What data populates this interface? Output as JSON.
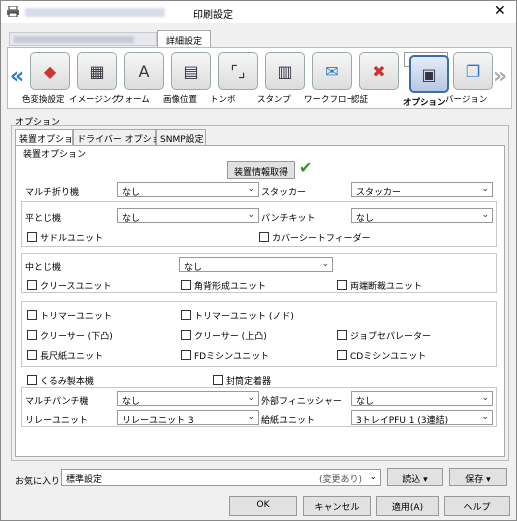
{
  "window": {
    "title": "印刷設定",
    "close": "✕"
  },
  "tabs": {
    "detail": "詳細設定"
  },
  "ribbon": {
    "items": [
      {
        "label": "色変換設定",
        "glyph": "◆"
      },
      {
        "label": "イメージング",
        "glyph": "▦"
      },
      {
        "label": "フォーム",
        "glyph": "A"
      },
      {
        "label": "画像位置",
        "glyph": "▤"
      },
      {
        "label": "トンボ",
        "glyph": "⌜⌟"
      },
      {
        "label": "スタンプ",
        "glyph": "▥"
      },
      {
        "label": "ワークフロー",
        "glyph": "✉"
      },
      {
        "label": "認証",
        "glyph": "✖"
      },
      {
        "label": "オプション",
        "glyph": "▣"
      },
      {
        "label": "バージョン",
        "glyph": "❐"
      }
    ],
    "left_arrow": "«",
    "right_arrow": "»"
  },
  "options": {
    "section_label": "オプション",
    "tabs": [
      "装置オプション",
      "ドライバー オプション",
      "SNMP設定"
    ],
    "group_label": "装置オプション",
    "get_info_button": "装置情報取得",
    "checkmark": "✔",
    "multi_fold": {
      "label": "マルチ折り機",
      "value": "なし"
    },
    "stacker": {
      "label": "スタッカー",
      "value": "スタッカー"
    },
    "flat_stitch": {
      "label": "平とじ機",
      "value": "なし"
    },
    "punch_kit": {
      "label": "パンチキット",
      "value": "なし"
    },
    "saddle_unit": "サドルユニット",
    "cover_feeder": "カバーシートフィーダー",
    "middle_stitch": {
      "label": "中とじ機",
      "value": "なし"
    },
    "crease_unit": "クリースユニット",
    "spine_unit": "角背形成ユニット",
    "both_trim": "両端断裁ユニット",
    "trimmer_unit": "トリマーユニット",
    "trimmer_unit_no": "トリマーユニット (ノド)",
    "creaser_down": "クリーサー (下凸)",
    "creaser_up": "クリーサー (上凸)",
    "job_separator": "ジョブセパレーター",
    "long_paper": "長尺紙ユニット",
    "fd_perf": "FDミシンユニット",
    "cd_perf": "CDミシンユニット",
    "kurumi_binder": "くるみ製本機",
    "envelope_inserter": "封筒定着器",
    "multi_punch": {
      "label": "マルチパンチ機",
      "value": "なし"
    },
    "ext_finisher": {
      "label": "外部フィニッシャー",
      "value": "なし"
    },
    "relay_unit": {
      "label": "リレーユニット",
      "value": "リレーユニット 3"
    },
    "feed_unit": {
      "label": "給紙ユニット",
      "value": "3トレイPFU 1 (3連結)"
    }
  },
  "favorites": {
    "label": "お気に入り",
    "value": "標準設定",
    "hint": "(変更あり)",
    "load": "読込",
    "save": "保存"
  },
  "buttons": {
    "ok": "OK",
    "cancel": "キャンセル",
    "apply": "適用(A)",
    "help": "ヘルプ"
  }
}
